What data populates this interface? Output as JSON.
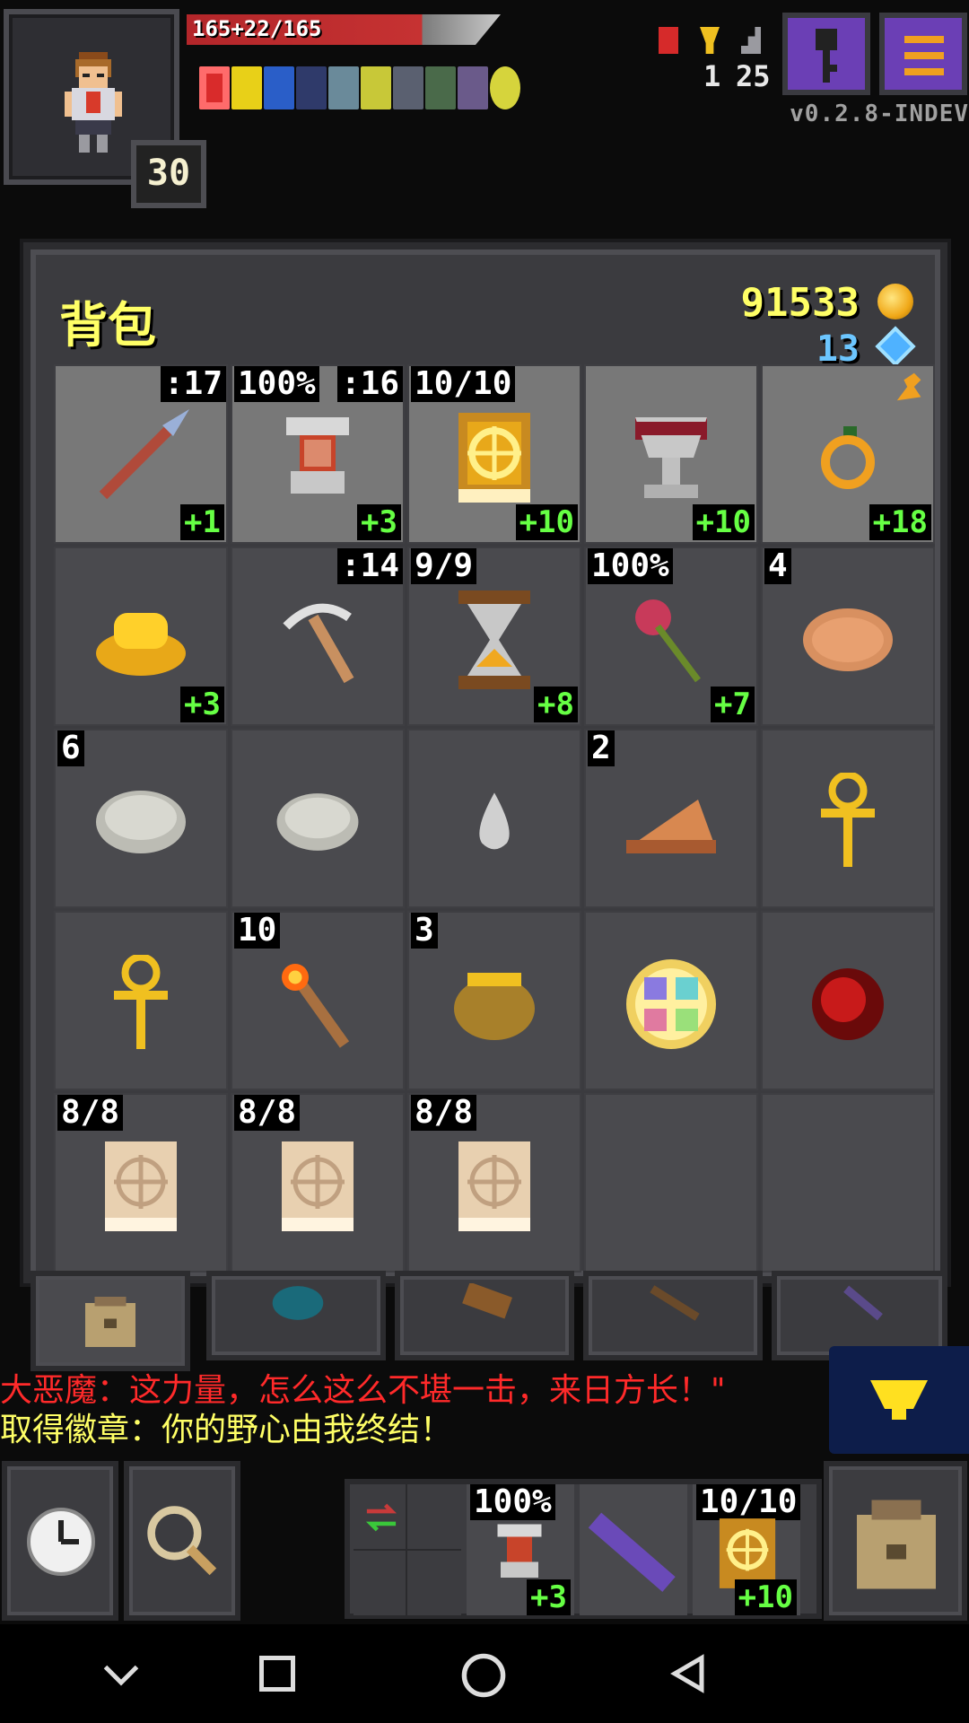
{
  "hud": {
    "hp_text": "165+22/165",
    "level": "30",
    "counter_a": "1",
    "counter_b": "25",
    "version": "v0.2.8-INDEV",
    "buff_colors": [
      "#d92b2b",
      "#e8d018",
      "#2a5ec8",
      "#2f3a6a",
      "#6a8a9a",
      "#c8c838",
      "#5a6070",
      "#4a6a4a",
      "#6a5a8a",
      "#d6d43c"
    ]
  },
  "backpack": {
    "title": "背包",
    "gold": "91533",
    "gems": "13",
    "slots": [
      {
        "name": "spear",
        "tl": "",
        "tr": ":17",
        "br": "+1",
        "hl": true
      },
      {
        "name": "armor",
        "tl": "100%",
        "tr": ":16",
        "br": "+3",
        "hl": true
      },
      {
        "name": "spellbook",
        "tl": "10/10",
        "tr": "",
        "br": "+10",
        "hl": true
      },
      {
        "name": "chalice",
        "tl": "",
        "tr": "",
        "br": "+10",
        "hl": true
      },
      {
        "name": "ring",
        "tl": "",
        "tr": "",
        "br": "+18",
        "hl": true
      },
      {
        "name": "gold-ingot",
        "tl": "",
        "tr": "",
        "br": "+3",
        "hl": false
      },
      {
        "name": "pickaxe",
        "tl": "",
        "tr": ":14",
        "br": "",
        "hl": false
      },
      {
        "name": "hourglass",
        "tl": "9/9",
        "tr": "",
        "br": "+8",
        "hl": false
      },
      {
        "name": "rose",
        "tl": "100%",
        "tr": "",
        "br": "+7",
        "hl": false
      },
      {
        "name": "pasty",
        "tl": "4",
        "tr": "",
        "br": "",
        "hl": false
      },
      {
        "name": "stone",
        "tl": "6",
        "tr": "",
        "br": "",
        "hl": false
      },
      {
        "name": "stone",
        "tl": "",
        "tr": "",
        "br": "",
        "hl": false
      },
      {
        "name": "drop",
        "tl": "",
        "tr": "",
        "br": "",
        "hl": false
      },
      {
        "name": "pie",
        "tl": "2",
        "tr": "",
        "br": "",
        "hl": false
      },
      {
        "name": "ankh",
        "tl": "",
        "tr": "",
        "br": "",
        "hl": false
      },
      {
        "name": "ankh",
        "tl": "",
        "tr": "",
        "br": "",
        "hl": false
      },
      {
        "name": "torch",
        "tl": "10",
        "tr": "",
        "br": "",
        "hl": false
      },
      {
        "name": "honeypot",
        "tl": "3",
        "tr": "",
        "br": "",
        "hl": false
      },
      {
        "name": "seal",
        "tl": "",
        "tr": "",
        "br": "",
        "hl": false
      },
      {
        "name": "red-orb",
        "tl": "",
        "tr": "",
        "br": "",
        "hl": false
      },
      {
        "name": "scroll",
        "tl": "8/8",
        "tr": "",
        "br": "",
        "hl": false
      },
      {
        "name": "scroll",
        "tl": "8/8",
        "tr": "",
        "br": "",
        "hl": false
      },
      {
        "name": "scroll",
        "tl": "8/8",
        "tr": "",
        "br": "",
        "hl": false
      },
      {
        "name": "empty",
        "tl": "",
        "tr": "",
        "br": "",
        "hl": false
      },
      {
        "name": "empty",
        "tl": "",
        "tr": "",
        "br": "",
        "hl": false
      }
    ]
  },
  "log": {
    "line1": "大恶魔：这力量，怎么这么不堪一击，来日方长！\"",
    "line2": "取得徽章：你的野心由我终结！"
  },
  "quickslots": {
    "slot1_tl": "100%",
    "slot1_br": "+3",
    "slot3_tl": "10/10",
    "slot3_br": "+10"
  }
}
